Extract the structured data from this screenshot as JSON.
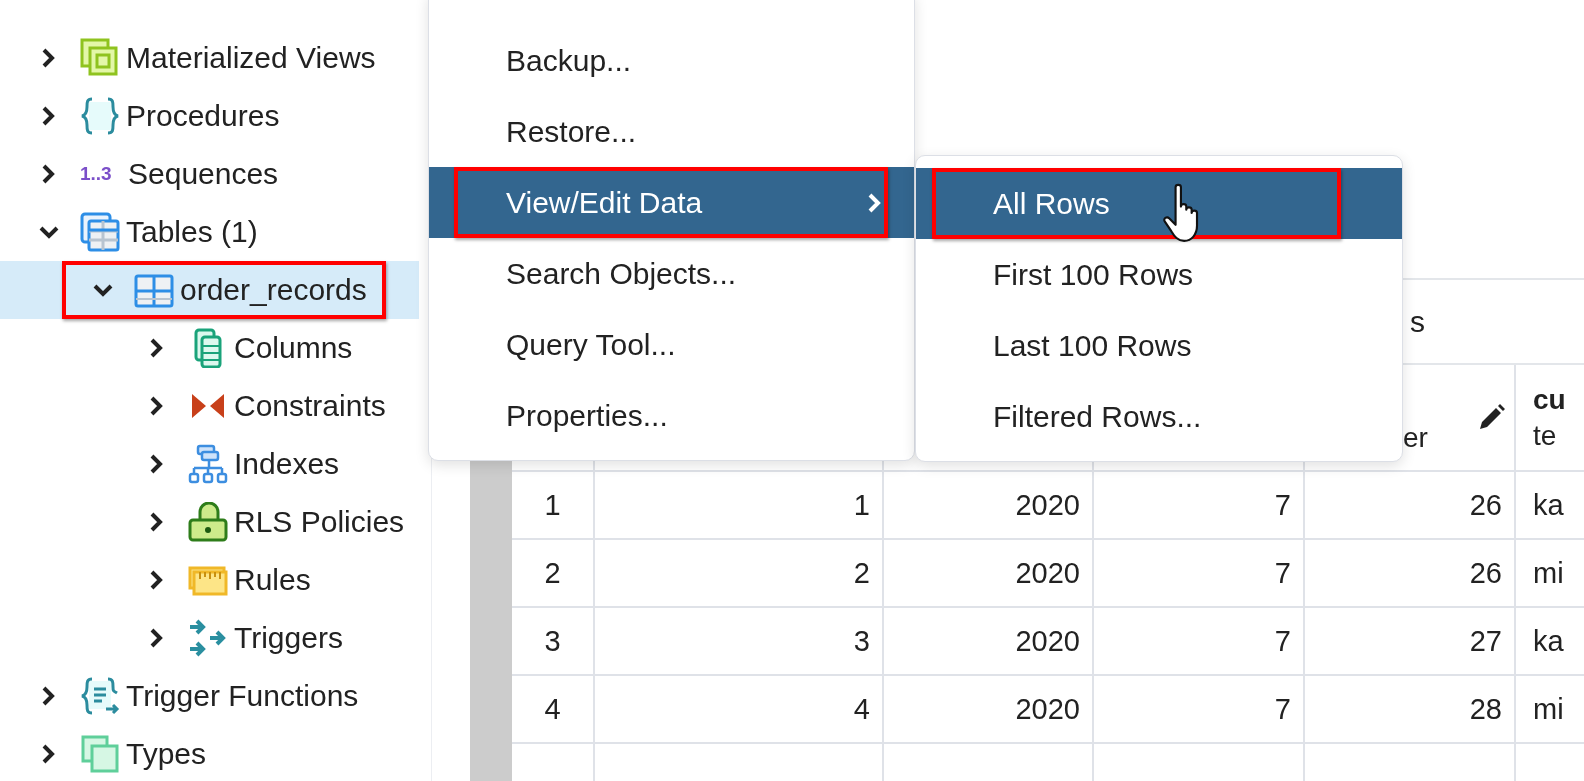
{
  "tree": [
    {
      "label": "Materialized Views",
      "kind": "mview",
      "expanded": false,
      "selected": false,
      "annotated": false
    },
    {
      "label": "Procedures",
      "kind": "procedure",
      "expanded": false,
      "selected": false,
      "annotated": false
    },
    {
      "label": "Sequences",
      "kind": "sequence",
      "badge": "1..3",
      "expanded": false,
      "selected": false,
      "annotated": false
    },
    {
      "label": "Tables (1)",
      "kind": "table-group",
      "expanded": true,
      "selected": false,
      "annotated": false,
      "children": [
        {
          "label": "order_records",
          "kind": "table",
          "expanded": true,
          "selected": true,
          "annotated": true,
          "children": [
            {
              "label": "Columns",
              "kind": "column",
              "expanded": false,
              "selected": false,
              "annotated": false
            },
            {
              "label": "Constraints",
              "kind": "constraint",
              "expanded": false,
              "selected": false,
              "annotated": false
            },
            {
              "label": "Indexes",
              "kind": "index",
              "expanded": false,
              "selected": false,
              "annotated": false
            },
            {
              "label": "RLS Policies",
              "kind": "policy",
              "expanded": false,
              "selected": false,
              "annotated": false
            },
            {
              "label": "Rules",
              "kind": "rule",
              "expanded": false,
              "selected": false,
              "annotated": false
            },
            {
              "label": "Triggers",
              "kind": "trigger",
              "expanded": false,
              "selected": false,
              "annotated": false
            }
          ]
        }
      ]
    },
    {
      "label": "Trigger Functions",
      "kind": "trigger-function",
      "expanded": false,
      "selected": false,
      "annotated": false
    },
    {
      "label": "Types",
      "kind": "type",
      "expanded": false,
      "selected": false,
      "annotated": false
    }
  ],
  "context_menu": {
    "items": [
      {
        "label": "Backup...",
        "selected": false,
        "annotated": false,
        "submenu": false
      },
      {
        "label": "Restore...",
        "selected": false,
        "annotated": false,
        "submenu": false
      },
      {
        "label": "View/Edit Data",
        "selected": true,
        "annotated": true,
        "submenu": true
      },
      {
        "label": "Search Objects...",
        "selected": false,
        "annotated": false,
        "submenu": false
      },
      {
        "label": "Query Tool...",
        "selected": false,
        "annotated": false,
        "submenu": false
      },
      {
        "label": "Properties...",
        "selected": false,
        "annotated": false,
        "submenu": false
      }
    ]
  },
  "submenu": {
    "items": [
      {
        "label": "All Rows",
        "selected": true,
        "annotated": true
      },
      {
        "label": "First 100 Rows",
        "selected": false,
        "annotated": false
      },
      {
        "label": "Last 100 Rows",
        "selected": false,
        "annotated": false
      },
      {
        "label": "Filtered Rows...",
        "selected": false,
        "annotated": false
      }
    ]
  },
  "panel_title": "s",
  "table": {
    "header": [
      {
        "type": "er",
        "editable": true
      },
      {
        "name": "cu",
        "type": "te",
        "editable": false
      }
    ],
    "rows": [
      {
        "number": "1",
        "cells": [
          "1",
          "2020",
          "7",
          "26",
          "ka"
        ]
      },
      {
        "number": "2",
        "cells": [
          "2",
          "2020",
          "7",
          "26",
          "mi"
        ]
      },
      {
        "number": "3",
        "cells": [
          "3",
          "2020",
          "7",
          "27",
          "ka"
        ]
      },
      {
        "number": "4",
        "cells": [
          "4",
          "2020",
          "7",
          "28",
          "mi"
        ]
      }
    ]
  }
}
